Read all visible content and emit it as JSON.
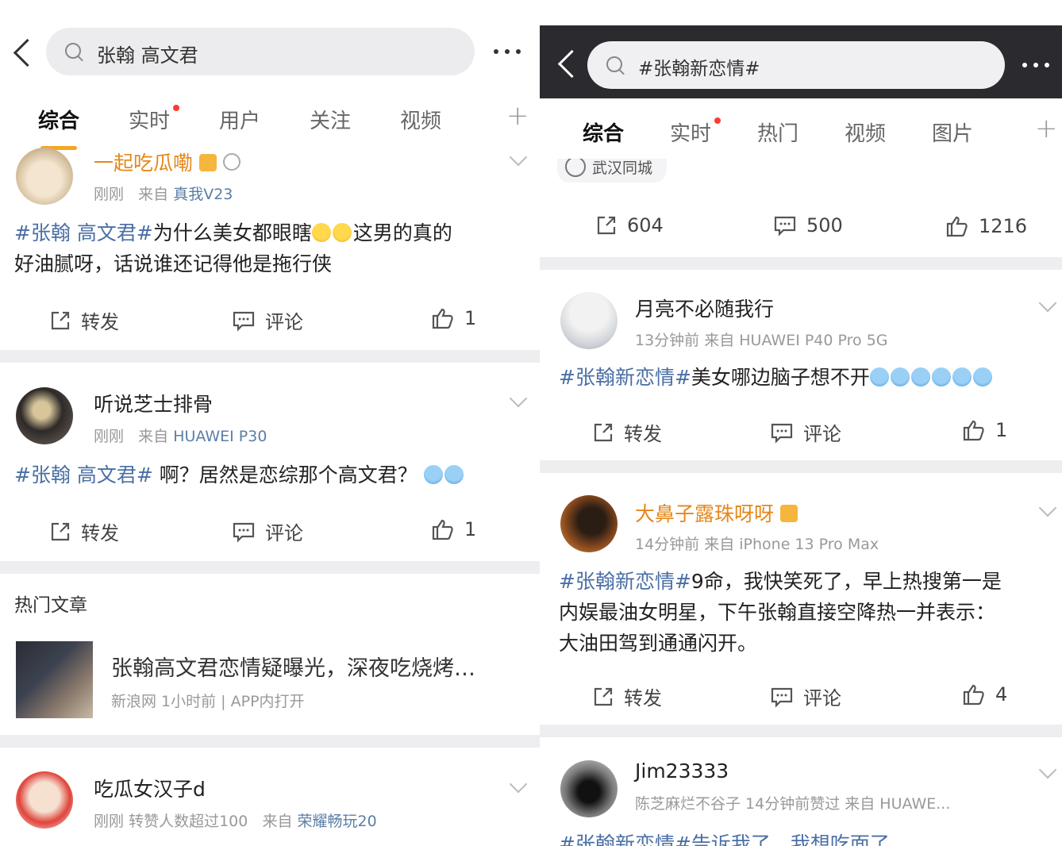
{
  "left": {
    "search_text": "张翰 高文君",
    "tabs": [
      {
        "label": "综合"
      },
      {
        "label": "实时"
      },
      {
        "label": "用户"
      },
      {
        "label": "关注"
      },
      {
        "label": "视频"
      }
    ],
    "posts": [
      {
        "username": "一起吃瓜嘞",
        "time": "刚刚",
        "from_label": "来自",
        "source": "真我V23",
        "tag": "#张翰 高文君#",
        "text_a": "为什么美女都眼瞎",
        "text_b": "这男的真的",
        "text_line2": "好油腻呀，话说谁还记得他是拖行侠",
        "repost": "转发",
        "comment": "评论",
        "likes": "1"
      },
      {
        "username": "听说芝士排骨",
        "time": "刚刚",
        "from_label": "来自",
        "source": "HUAWEI P30",
        "tag": "#张翰 高文君#",
        "text": " 啊？居然是恋综那个高文君？",
        "repost": "转发",
        "comment": "评论",
        "likes": "1"
      }
    ],
    "hot_articles": {
      "heading": "热门文章",
      "title": "张翰高文君恋情疑曝光，深夜吃烧烤…",
      "meta": "新浪网  1小时前 | APP内打开"
    },
    "post3": {
      "username": "吃瓜女汉子d",
      "time": "刚刚",
      "note": "转赞人数超过100",
      "from_label": "来自",
      "source": "荣耀畅玩20"
    }
  },
  "right": {
    "search_text": "#张翰新恋情#",
    "tabs": [
      {
        "label": "综合"
      },
      {
        "label": "实时"
      },
      {
        "label": "热门"
      },
      {
        "label": "视频"
      },
      {
        "label": "图片"
      }
    ],
    "location": "武汉同城",
    "top_stats": {
      "reposts": "604",
      "comments": "500",
      "likes": "1216"
    },
    "posts": [
      {
        "username": "月亮不必随我行",
        "meta": "13分钟前  来自 HUAWEI P40 Pro 5G",
        "tag": "#张翰新恋情#",
        "text": "美女哪边脑子想不开",
        "repost": "转发",
        "comment": "评论",
        "likes": "1"
      },
      {
        "username": "大鼻子露珠呀呀",
        "meta": "14分钟前  来自 iPhone 13 Pro Max",
        "tag": "#张翰新恋情#",
        "line1": "9命，我快笑死了，早上热搜第一是",
        "line2": "内娱最油女明星，下午张翰直接空降热一并表示：",
        "line3": "大油田驾到通通闪开。",
        "repost": "转发",
        "comment": "评论",
        "likes": "4"
      },
      {
        "username": "Jim23333",
        "meta": "陈芝麻烂不谷子  14分钟前赞过  来自 HUAWE...",
        "partial_text": "#张翰新恋情#告诉我了，我想吃面了"
      }
    ]
  },
  "colors": {
    "accent": "#f5a623",
    "tag": "#4a6fa5",
    "separator": "#eeeef0",
    "vip": "#e6871a",
    "dark_header": "#2b2b2f"
  },
  "icons": [
    "back-icon",
    "search-icon",
    "more-icon",
    "add-tab-icon",
    "repost-icon",
    "comment-icon",
    "like-icon",
    "chevron-down-icon",
    "crown-icon",
    "medal-icon",
    "location-icon"
  ]
}
